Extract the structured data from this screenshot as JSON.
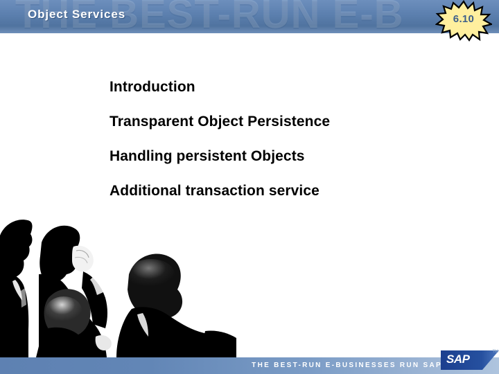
{
  "slide": {
    "header": {
      "title": "Object Services",
      "watermark": "THE BEST-RUN E-B",
      "background_color": "#5b7fae",
      "title_color": "#ffffff"
    },
    "version_badge": {
      "label": "6.10",
      "shape": "starburst-icon",
      "fill_color": "#ffef9e",
      "outline_color": "#000000",
      "text_color": "#3d5f8a"
    },
    "content": {
      "bullets": [
        {
          "text": "Introduction"
        },
        {
          "text": "Transparent Object Persistence"
        },
        {
          "text": "Handling persistent Objects"
        },
        {
          "text": "Additional transaction service"
        }
      ]
    },
    "photo": {
      "description": "business-people-photo"
    },
    "footer": {
      "tagline": "THE BEST-RUN E-BUSINESSES RUN SAP",
      "logo_text": "SAP",
      "logo_trademark": "TM",
      "bar_color": "#6286b6",
      "logo_color": "#1b3f8f"
    }
  }
}
